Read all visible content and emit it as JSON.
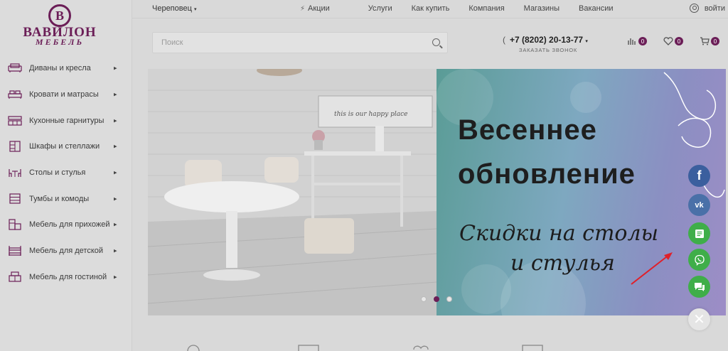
{
  "logo": {
    "letter": "В",
    "name": "ВАВИЛОН",
    "sub": "МЕБЕЛЬ"
  },
  "header": {
    "city": "Череповец",
    "nav": [
      "Акции",
      "Услуги",
      "Как купить",
      "Компания",
      "Магазины",
      "Вакансии"
    ],
    "login": "войти",
    "search_placeholder": "Поиск",
    "phone": "+7 (8202) 20-13-77",
    "callback": "ЗАКАЗАТЬ ЗВОНОК",
    "compare_count": "0",
    "favorites_count": "0",
    "cart_count": "0"
  },
  "menu": [
    {
      "label": "Диваны и кресла",
      "icon": "sofa-icon"
    },
    {
      "label": "Кровати и матрасы",
      "icon": "bed-icon"
    },
    {
      "label": "Кухонные гарнитуры",
      "icon": "kitchen-icon"
    },
    {
      "label": "Шкафы и стеллажи",
      "icon": "wardrobe-icon"
    },
    {
      "label": "Столы и стулья",
      "icon": "table-icon"
    },
    {
      "label": "Тумбы и комоды",
      "icon": "dresser-icon"
    },
    {
      "label": "Мебель для прихожей",
      "icon": "hallway-icon"
    },
    {
      "label": "Мебель для детской",
      "icon": "bunkbed-icon"
    },
    {
      "label": "Мебель для гостиной",
      "icon": "livingroom-icon"
    }
  ],
  "banner": {
    "title_line1": "Весеннее",
    "title_line2": "обновление",
    "sub_line1": "Скидки на столы",
    "sub_line2": "и стулья",
    "photo_sign": "this is our happy place",
    "slide_count": 3,
    "active_slide": 2
  },
  "social": {
    "facebook": "f",
    "vk": "vk"
  },
  "colors": {
    "brand": "#6b1e57",
    "green": "#3fae49",
    "facebook": "#3b5f9e",
    "vk": "#4a70a8",
    "arrow": "#e0202a"
  }
}
